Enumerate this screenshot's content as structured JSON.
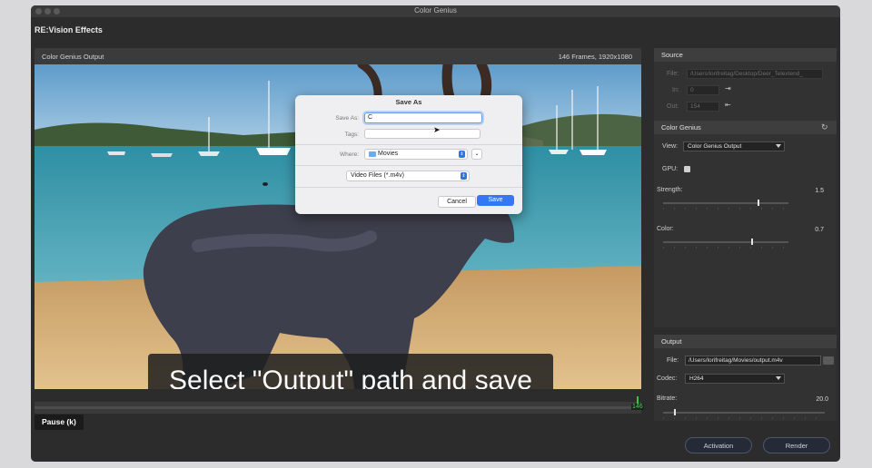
{
  "window": {
    "title": "Color Genius"
  },
  "app": {
    "brand": "RE:Vision Effects"
  },
  "viewer": {
    "label": "Color Genius Output",
    "info": "146 Frames, 1920x1080",
    "caption": "Select \"Output\" path and save",
    "frame_number": "146",
    "pause_label": "Pause (k)"
  },
  "dialog": {
    "title": "Save As",
    "save_as_label": "Save As:",
    "save_as_value": "C",
    "tags_label": "Tags:",
    "tags_value": "",
    "where_label": "Where:",
    "where_value": "Movies",
    "format_value": "Video Files (*.m4v)",
    "cancel_label": "Cancel",
    "save_label": "Save",
    "folder_icon": "folder-icon"
  },
  "source": {
    "header": "Source",
    "file_label": "File:",
    "file_value": "/Users/lorifreitag/Desktop/Deer_Telextend_",
    "in_label": "In:",
    "in_value": "0",
    "out_label": "Out:",
    "out_value": "154"
  },
  "color_genius": {
    "header": "Color Genius",
    "view_label": "View:",
    "view_value": "Color Genius Output",
    "gpu_label": "GPU:",
    "gpu_checked": true,
    "strength_label": "Strength:",
    "strength_value": "1.5",
    "strength_level": 0.75,
    "color_label": "Color:",
    "color_value": "0.7",
    "color_level": 0.7
  },
  "output": {
    "header": "Output",
    "file_label": "File:",
    "file_value": "/Users/lorifreitag/Movies/output.m4v",
    "codec_label": "Codec:",
    "codec_value": "H264",
    "bitrate_label": "Bitrate:",
    "bitrate_value": "20.0",
    "bitrate_level": 0.07
  },
  "footer": {
    "activation_label": "Activation",
    "render_label": "Render"
  },
  "colors": {
    "accent": "#3478f6",
    "frame_counter": "#48d04f",
    "panel": "#323232"
  }
}
